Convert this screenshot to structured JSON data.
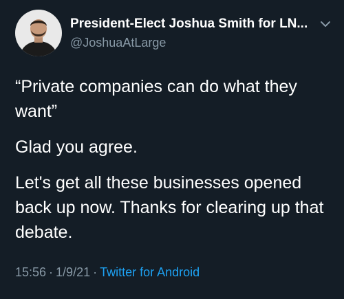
{
  "tweet": {
    "author": {
      "display_name": "President-Elect Joshua Smith for LN...",
      "handle": "@JoshuaAtLarge"
    },
    "paragraphs": [
      "“Private companies can do what they want”",
      "Glad you agree.",
      "Let's get all these businesses opened back up now. Thanks for clearing up that debate."
    ],
    "meta": {
      "time": "15:56",
      "separator": "·",
      "date": "1/9/21",
      "source": "Twitter for Android"
    }
  },
  "colors": {
    "background": "#141d26",
    "text": "#ffffff",
    "secondary": "#8899a6",
    "link": "#1da1f2"
  },
  "icons": {
    "menu": "chevron-down-icon"
  }
}
